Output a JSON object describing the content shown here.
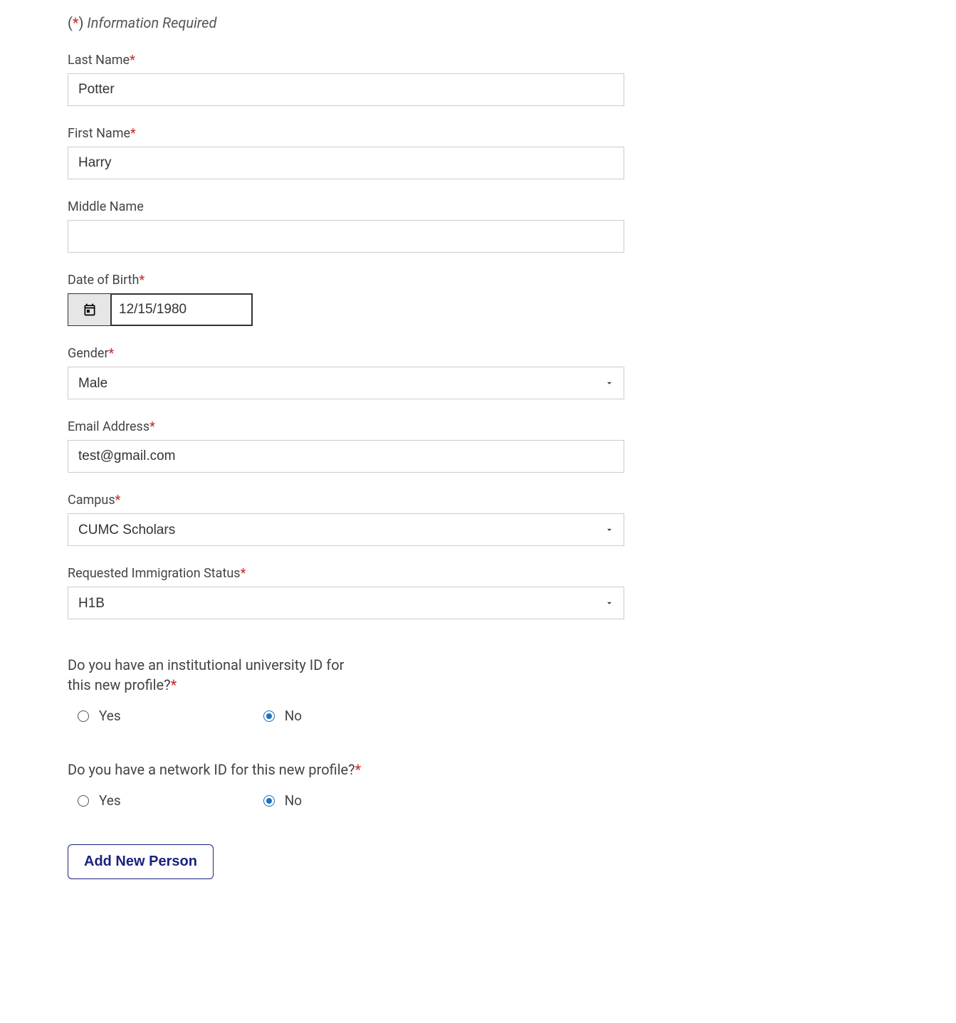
{
  "header": {
    "left_paren": "(",
    "asterisk": "*",
    "right_paren": ") ",
    "text": "Information Required"
  },
  "fields": {
    "last_name": {
      "label": "Last Name",
      "value": "Potter"
    },
    "first_name": {
      "label": "First Name",
      "value": "Harry"
    },
    "middle_name": {
      "label": "Middle Name",
      "value": ""
    },
    "dob": {
      "label": "Date of Birth",
      "value": "12/15/1980"
    },
    "gender": {
      "label": "Gender",
      "value": "Male"
    },
    "email": {
      "label": "Email Address",
      "value": "test@gmail.com"
    },
    "campus": {
      "label": "Campus",
      "value": "CUMC Scholars"
    },
    "immigration": {
      "label": "Requested Immigration Status",
      "value": "H1B"
    }
  },
  "questions": {
    "institutional_id": {
      "text": "Do you have an institutional university ID for this new profile?",
      "yes": "Yes",
      "no": "No",
      "selected": "no"
    },
    "network_id": {
      "text": "Do you have a network ID for this new profile?",
      "yes": "Yes",
      "no": "No",
      "selected": "no"
    }
  },
  "submit": {
    "label": "Add New Person"
  },
  "required_marker": "*"
}
